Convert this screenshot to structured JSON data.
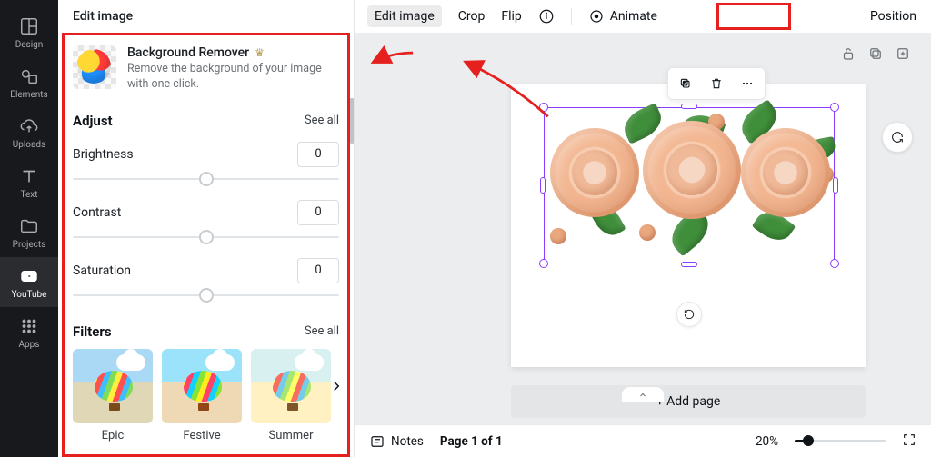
{
  "vnav": {
    "items": [
      {
        "label": "Design"
      },
      {
        "label": "Elements"
      },
      {
        "label": "Uploads"
      },
      {
        "label": "Text"
      },
      {
        "label": "Projects"
      },
      {
        "label": "YouTube"
      },
      {
        "label": "Apps"
      }
    ],
    "active_index": 5
  },
  "sidepanel": {
    "title": "Edit image",
    "bg_remover": {
      "title": "Background Remover",
      "desc": "Remove the background of your image with one click."
    },
    "adjust": {
      "title": "Adjust",
      "see_all": "See all",
      "params": [
        {
          "label": "Brightness",
          "value": "0"
        },
        {
          "label": "Contrast",
          "value": "0"
        },
        {
          "label": "Saturation",
          "value": "0"
        }
      ]
    },
    "filters": {
      "title": "Filters",
      "see_all": "See all",
      "items": [
        {
          "name": "Epic"
        },
        {
          "name": "Festive"
        },
        {
          "name": "Summer"
        }
      ]
    }
  },
  "toolbar": {
    "edit_image": "Edit image",
    "crop": "Crop",
    "flip": "Flip",
    "animate": "Animate",
    "position": "Position"
  },
  "canvas": {
    "add_page": "+ Add page"
  },
  "footer": {
    "notes": "Notes",
    "pager": "Page 1 of 1",
    "zoom_label": "20%",
    "zoom_percent": 20
  },
  "annotation": {
    "highlight_color": "#e6201f"
  }
}
